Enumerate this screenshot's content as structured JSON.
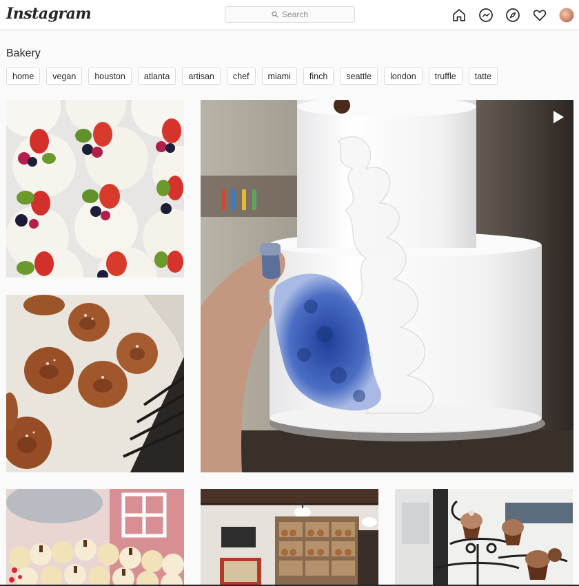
{
  "header": {
    "logo": "Instagram",
    "search_placeholder": "Search",
    "icons": [
      "home-icon",
      "messenger-icon",
      "explore-icon",
      "heart-icon",
      "profile-avatar"
    ]
  },
  "page": {
    "title": "Bakery",
    "tags": [
      "home",
      "vegan",
      "houston",
      "atlanta",
      "artisan",
      "chef",
      "miami",
      "finch",
      "seattle",
      "london",
      "truffle",
      "tatte"
    ]
  },
  "posts": [
    {
      "subject": "fruit pavlovas"
    },
    {
      "subject": "cinnamon knots"
    },
    {
      "subject": "blue frosted two-tier cake",
      "media": "video"
    },
    {
      "subject": "cupcakes display"
    },
    {
      "subject": "bakery shop interior"
    },
    {
      "subject": "chocolate cupcakes stand"
    }
  ],
  "colors": {
    "text": "#262626",
    "border": "#dbdbdb",
    "background": "#fafafa"
  }
}
